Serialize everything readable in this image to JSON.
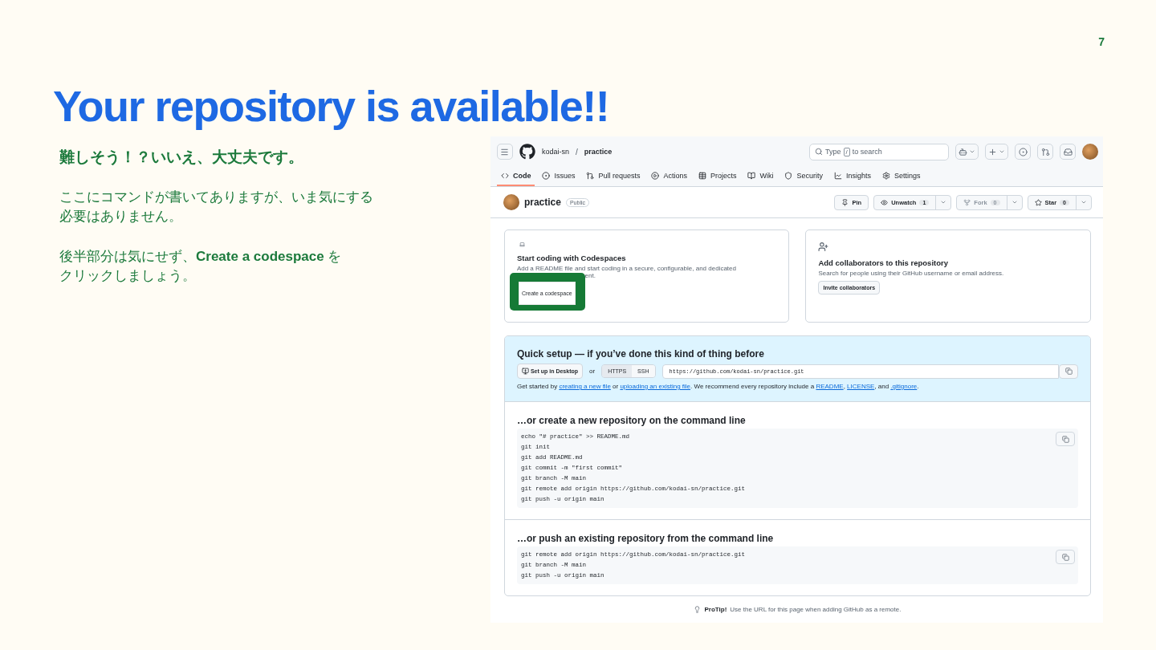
{
  "page_number": "7",
  "title": "Your repository is available!!",
  "notes": [
    {
      "kind": "heading",
      "lines": [
        "難しそう！？いいえ、大丈夫です。"
      ]
    },
    {
      "kind": "paragraph",
      "lines": [
        "ここにコマンドが書いてありますが、いま気にする",
        "必要はありません。"
      ]
    },
    {
      "kind": "paragraph",
      "lines": [
        "後半部分は気にせず、**Create a codespace** を",
        "クリックしましょう。"
      ]
    }
  ],
  "screenshot": {
    "header": {
      "owner": "kodai-sn",
      "separator": "/",
      "repo": "practice",
      "search": {
        "prefix": "Type",
        "key": "/",
        "suffix": "to search"
      }
    },
    "tabs": [
      {
        "kind": "code",
        "label": "Code",
        "selected": true
      },
      {
        "kind": "issues",
        "label": "Issues",
        "selected": false
      },
      {
        "kind": "pulls",
        "label": "Pull requests",
        "selected": false
      },
      {
        "kind": "actions",
        "label": "Actions",
        "selected": false
      },
      {
        "kind": "projects",
        "label": "Projects",
        "selected": false
      },
      {
        "kind": "wiki",
        "label": "Wiki",
        "selected": false
      },
      {
        "kind": "security",
        "label": "Security",
        "selected": false
      },
      {
        "kind": "insights",
        "label": "Insights",
        "selected": false
      },
      {
        "kind": "settings",
        "label": "Settings",
        "selected": false
      }
    ],
    "repo": {
      "name": "practice",
      "visibility": "Public",
      "actions": [
        {
          "kind": "pin",
          "label": "Pin",
          "disabled": false
        },
        {
          "kind": "watch",
          "label": "Unwatch",
          "count": "1",
          "disabled": false
        },
        {
          "kind": "fork",
          "label": "Fork",
          "count": "0",
          "disabled": true
        },
        {
          "kind": "star",
          "label": "Star",
          "count": "0",
          "disabled": false
        }
      ]
    },
    "cards": [
      {
        "kind": "codespaces",
        "title": "Start coding with Codespaces",
        "description": "Add a README file and start coding in a secure, configurable, and dedicated",
        "description_tail": "ent.",
        "button": "Create a codespace",
        "highlighted": true
      },
      {
        "kind": "collaborators",
        "title": "Add collaborators to this repository",
        "description": "Search for people using their GitHub username or email address.",
        "button": "Invite collaborators",
        "highlighted": false
      }
    ],
    "quick_setup": {
      "title": "Quick setup — if you’ve done this kind of thing before",
      "desktop_button": "Set up in Desktop",
      "or": "or",
      "protocols": [
        {
          "label": "HTTPS",
          "selected": true
        },
        {
          "label": "SSH",
          "selected": false
        }
      ],
      "url": "https://github.com/kodai-sn/practice.git",
      "hint": [
        {
          "kind": "text",
          "text": "Get started by "
        },
        {
          "kind": "link",
          "text": "creating a new file"
        },
        {
          "kind": "text",
          "text": " or "
        },
        {
          "kind": "link",
          "text": "uploading an existing file"
        },
        {
          "kind": "text",
          "text": ". We recommend every repository include a "
        },
        {
          "kind": "link",
          "text": "README"
        },
        {
          "kind": "text",
          "text": ", "
        },
        {
          "kind": "link",
          "text": "LICENSE"
        },
        {
          "kind": "text",
          "text": ", and "
        },
        {
          "kind": "link",
          "text": ".gitignore"
        },
        {
          "kind": "text",
          "text": "."
        }
      ]
    },
    "sections": [
      {
        "title": "…or create a new repository on the command line",
        "lines": [
          "echo \"# practice\" >> README.md",
          "git init",
          "git add README.md",
          "git commit -m \"first commit\"",
          "git branch -M main",
          "git remote add origin https://github.com/kodai-sn/practice.git",
          "git push -u origin main"
        ]
      },
      {
        "title": "…or push an existing repository from the command line",
        "lines": [
          "git remote add origin https://github.com/kodai-sn/practice.git",
          "git branch -M main",
          "git push -u origin main"
        ]
      }
    ],
    "protip": {
      "label": "ProTip!",
      "text": "Use the URL for this page when adding GitHub as a remote."
    }
  }
}
